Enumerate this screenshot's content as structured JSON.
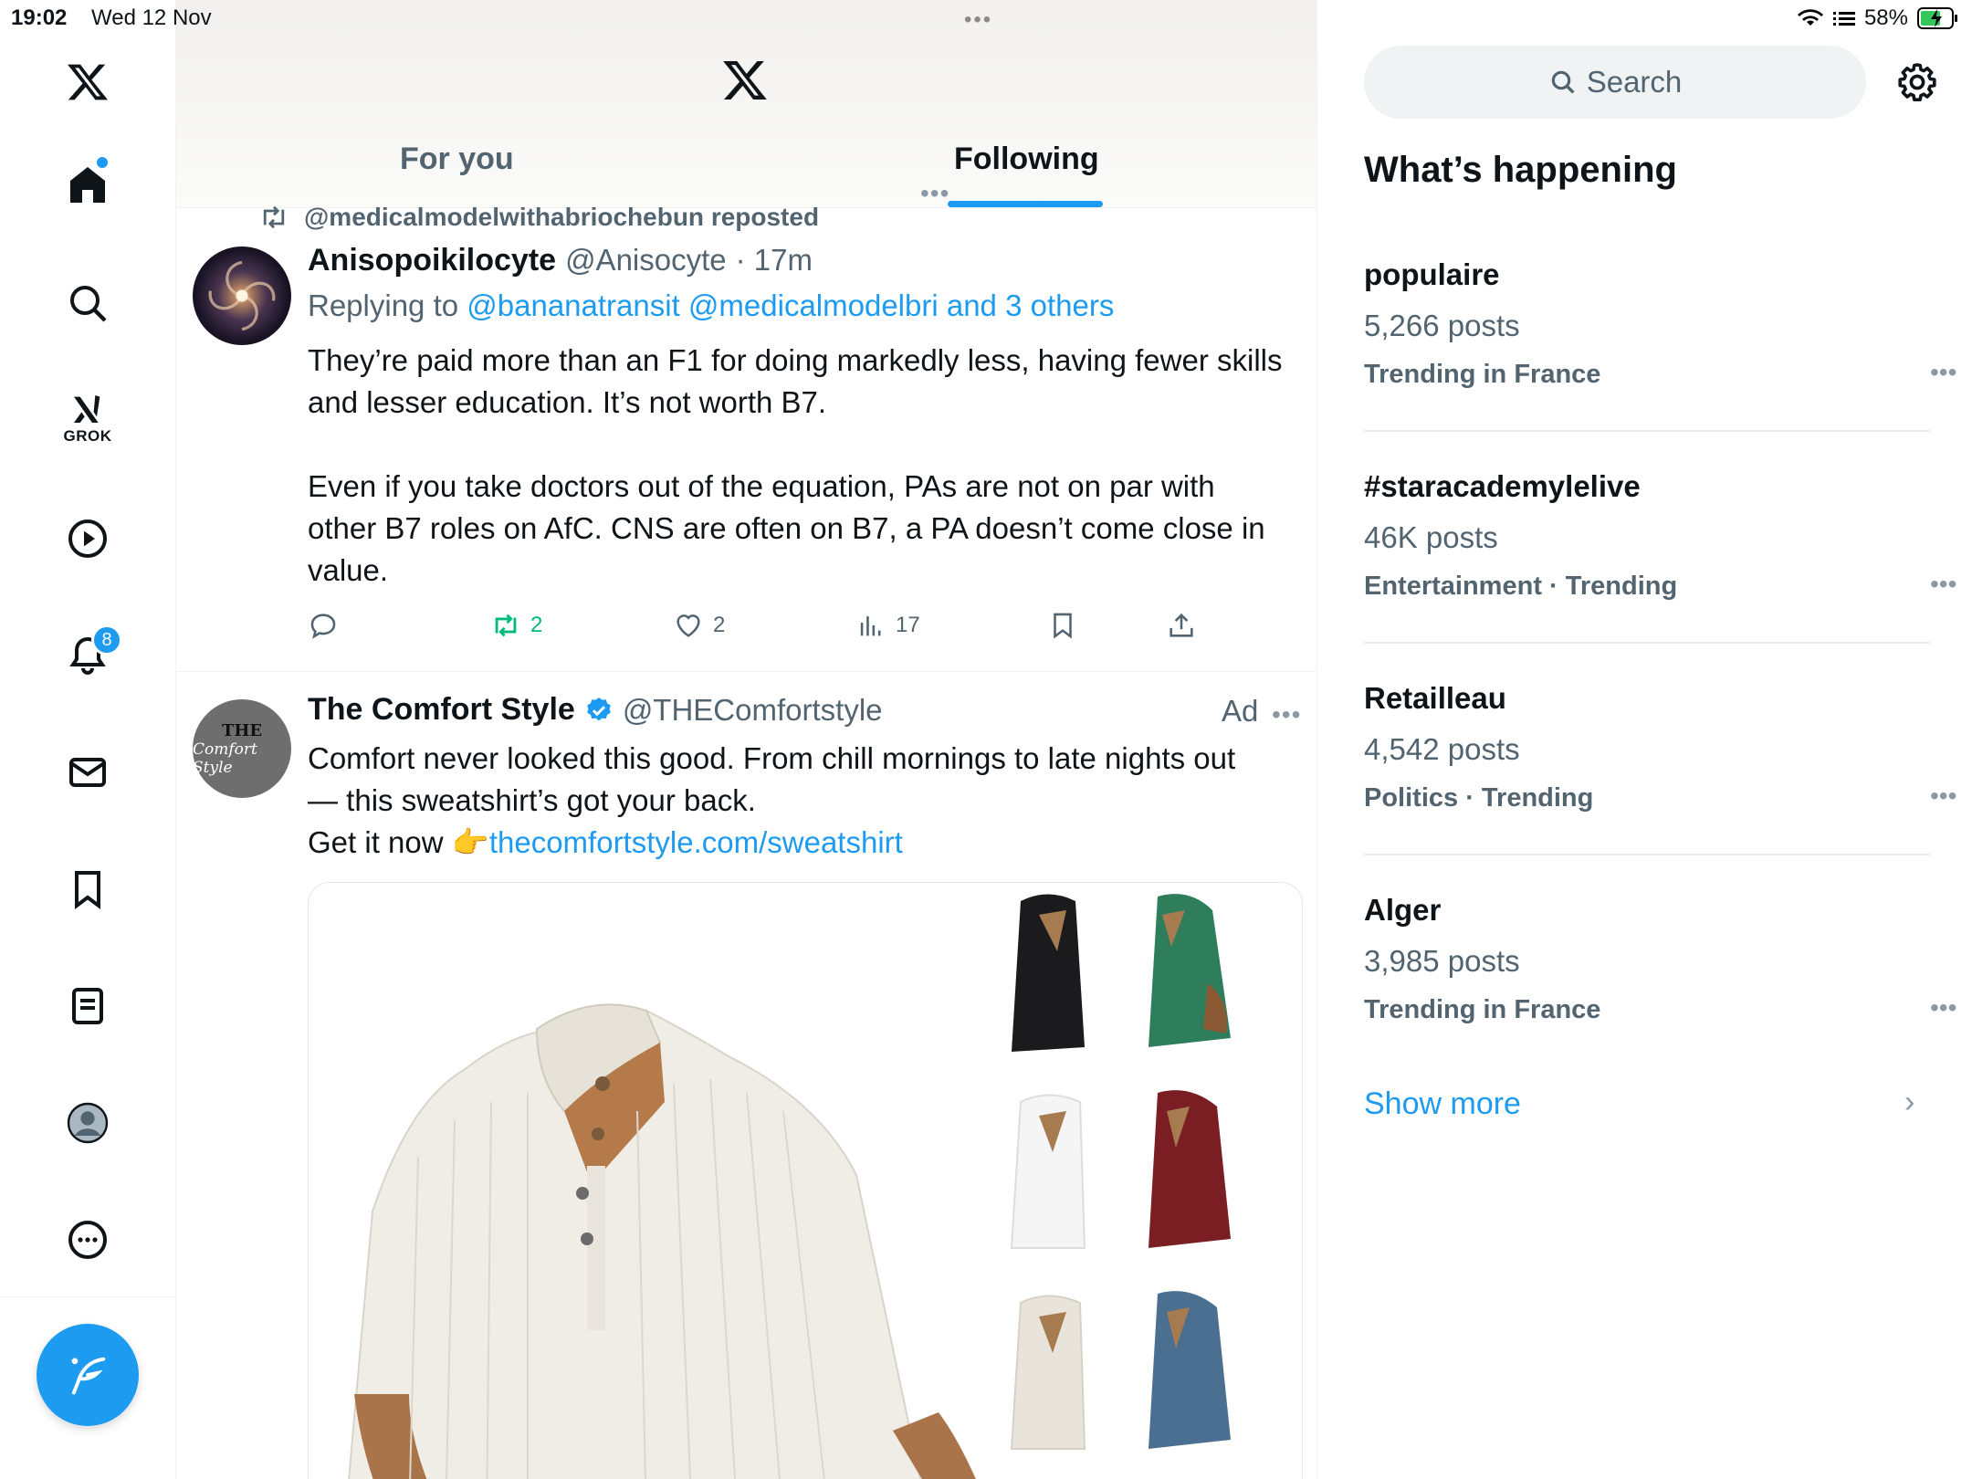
{
  "status_bar": {
    "time": "19:02",
    "date": "Wed 12 Nov",
    "battery": "58%"
  },
  "nav": {
    "notifications_badge": "8",
    "grok_label": "GROK"
  },
  "header": {
    "tabs": [
      {
        "label": "For you"
      },
      {
        "label": "Following"
      }
    ]
  },
  "post1": {
    "repost_by": "@medicalmodelwithabriochebun reposted",
    "name": "Anisopoikilocyte",
    "handle": "@Anisocyte",
    "time": "· 17m",
    "replying_prefix": "Replying to ",
    "replying_to": "@bananatransit @medicalmodelbri and 3 others",
    "paragraph1": "They’re paid more than an F1 for doing markedly less, having fewer skills and lesser education. It’s not worth B7.",
    "paragraph2": "Even if you take doctors out of the equation, PAs are not on par with other B7 roles on AfC. CNS are often on B7, a PA doesn’t come close in value.",
    "reposts": "2",
    "likes": "2",
    "views": "17"
  },
  "post2": {
    "name": "The Comfort Style",
    "handle": "@THEComfortstyle",
    "ad_label": "Ad",
    "avatar_line1": "THE",
    "avatar_line2": "Comfort Style",
    "line1": "Comfort never looked this good. From chill mornings to late nights out",
    "line2": "— this sweatshirt’s got your back.",
    "line3_prefix": "Get it now 👉",
    "link": "thecomfortstyle.com/sweatshirt",
    "colors": [
      "#efede6",
      "#1b1b1d",
      "#2e7d5b",
      "#f5f5f5",
      "#7a1e24",
      "#e8e4dc",
      "#4a6f90"
    ]
  },
  "sidebar": {
    "search_placeholder": "Search",
    "title": "What’s happening",
    "trends": [
      {
        "name": "populaire",
        "posts": "5,266 posts",
        "meta": "Trending in France"
      },
      {
        "name": "#staracademylelive",
        "posts": "46K posts",
        "meta": "Entertainment · Trending"
      },
      {
        "name": "Retailleau",
        "posts": "4,542 posts",
        "meta": "Politics · Trending"
      },
      {
        "name": "Alger",
        "posts": "3,985 posts",
        "meta": "Trending in France"
      }
    ],
    "show_more": "Show more"
  }
}
